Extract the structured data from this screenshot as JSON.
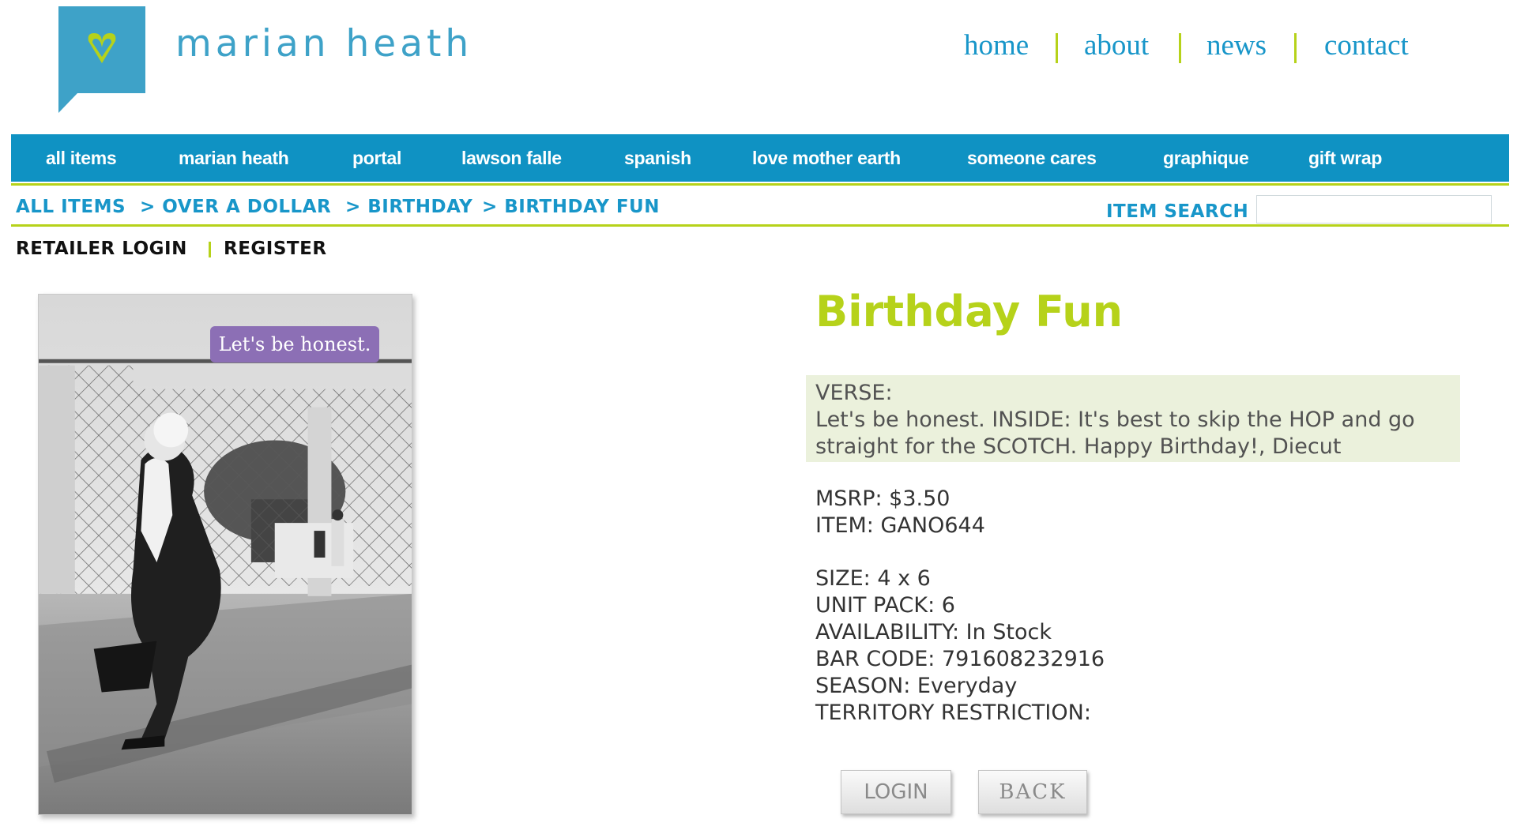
{
  "brand": {
    "name": "marian heath",
    "colors": {
      "blue": "#1896c9",
      "green": "#b6d21a",
      "logo_blue": "#3ea2c8",
      "caption_purple": "#8c6fb5"
    }
  },
  "top_nav": {
    "items": [
      "home",
      "about",
      "news",
      "contact"
    ]
  },
  "categories": [
    "all items",
    "marian heath",
    "portal",
    "lawson falle",
    "spanish",
    "love mother earth",
    "someone cares",
    "graphique",
    "gift wrap"
  ],
  "breadcrumb": [
    "ALL ITEMS",
    "> OVER A DOLLAR",
    "> BIRTHDAY",
    "> BIRTHDAY FUN"
  ],
  "search": {
    "label": "ITEM SEARCH",
    "value": ""
  },
  "account": {
    "login": "RETAILER LOGIN",
    "register": "REGISTER"
  },
  "product": {
    "image_caption": "Let's be honest.",
    "title": "Birthday Fun",
    "verse_label": "VERSE:",
    "verse_line1": "Let's be honest. INSIDE: It's best to skip the HOP and go",
    "verse_line2": "straight for the SCOTCH. Happy Birthday!, Diecut",
    "msrp": "MSRP: $3.50",
    "item": "ITEM: GANO644",
    "size": "SIZE: 4 x 6",
    "unit_pack": "UNIT PACK: 6",
    "availability": "AVAILABILITY: In Stock",
    "bar_code": "BAR CODE: 791608232916",
    "season": "SEASON: Everyday",
    "territory": "TERRITORY RESTRICTION:"
  },
  "buttons": {
    "login": "LOGIN",
    "back": "BACK"
  }
}
